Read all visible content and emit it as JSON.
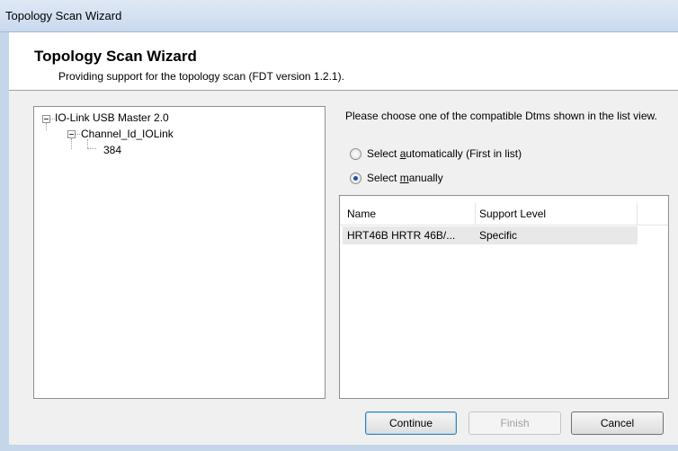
{
  "window": {
    "title": "Topology Scan Wizard"
  },
  "header": {
    "title": "Topology Scan Wizard",
    "subtitle": "Providing support for the topology scan (FDT version 1.2.1)."
  },
  "tree": {
    "root": "IO-Link USB Master 2.0",
    "child": "Channel_Id_IOLink",
    "leaf": "384"
  },
  "selection": {
    "prompt": "Please choose one of the compatible Dtms shown in the list view.",
    "auto_label": "Select automatically (First in list)",
    "manual_label": "Select manually",
    "selected": "manual"
  },
  "list": {
    "columns": [
      "Name",
      "Support Level"
    ],
    "rows": [
      {
        "name": "HRT46B HRTR 46B/...",
        "support": "Specific"
      }
    ]
  },
  "buttons": {
    "continue": "Continue",
    "finish": "Finish",
    "cancel": "Cancel"
  }
}
